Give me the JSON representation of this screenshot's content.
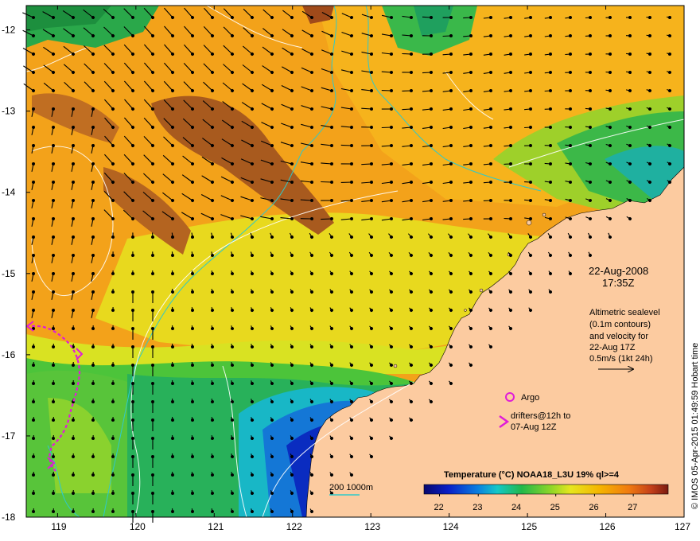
{
  "map": {
    "lat_ticks": [
      "-12",
      "-13",
      "-14",
      "-15",
      "-16",
      "-17",
      "-18"
    ],
    "lon_ticks": [
      "119",
      "120",
      "121",
      "122",
      "123",
      "124",
      "125",
      "126",
      "127"
    ],
    "extent": {
      "lon_min": 118.6,
      "lon_max": 127.0,
      "lat_min": -18.0,
      "lat_max": -11.7
    }
  },
  "annotations": {
    "date": "22-Aug-2008",
    "time": "17:35Z",
    "sealevel_lines": [
      "Altimetric sealevel",
      "(0.1m contours)",
      "and velocity for",
      "22-Aug 17Z"
    ],
    "speed_scale": "0.5m/s (1kt 24h)",
    "argo_label": "Argo",
    "drifters_lines": [
      "drifters@12h to",
      "07-Aug 12Z"
    ],
    "bathy_label": "200  1000m"
  },
  "colorbar": {
    "title": "Temperature (°C) NOAA18_L3U 19% ql>=4",
    "ticks": [
      "22",
      "23",
      "24",
      "25",
      "26",
      "27"
    ],
    "range": [
      21.6,
      27.9
    ]
  },
  "credit": "© IMOS 05-Apr-2015 01:49:59 Hobart time",
  "colors": {
    "land": "#fccba0",
    "warm_sst": "#f5a800",
    "hot_sst": "#a85a1e",
    "cool_sst": "#1d9e52",
    "bathy_line": "#2fc9c9",
    "drifter": "#e01cd8"
  }
}
